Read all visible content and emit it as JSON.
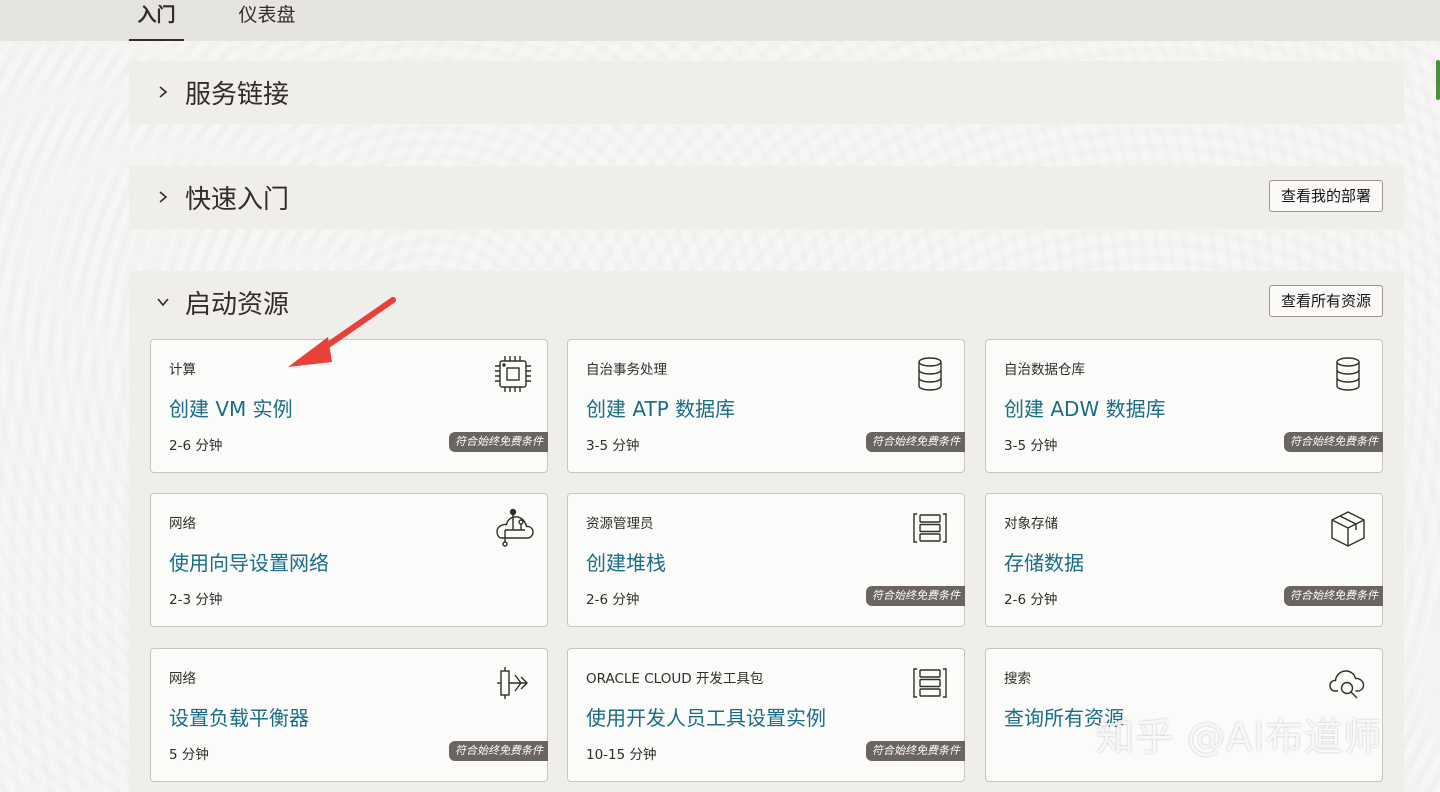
{
  "tabs": [
    {
      "label": "入门",
      "active": true
    },
    {
      "label": "仪表盘",
      "active": false
    }
  ],
  "panels": {
    "service_links": {
      "title": "服务链接"
    },
    "quick_start": {
      "title": "快速入门",
      "button": "查看我的部署"
    },
    "launch": {
      "title": "启动资源",
      "button": "查看所有资源"
    }
  },
  "cards": [
    {
      "category": "计算",
      "title": "创建 VM 实例",
      "time": "2-6 分钟",
      "badge": "符合始终免费条件",
      "icon": "chip-icon"
    },
    {
      "category": "自治事务处理",
      "title": "创建 ATP 数据库",
      "time": "3-5 分钟",
      "badge": "符合始终免费条件",
      "icon": "database-icon"
    },
    {
      "category": "自治数据仓库",
      "title": "创建 ADW 数据库",
      "time": "3-5 分钟",
      "badge": "符合始终免费条件",
      "icon": "database-icon"
    },
    {
      "category": "网络",
      "title": "使用向导设置网络",
      "time": "2-3 分钟",
      "badge": "",
      "icon": "cloud-network-icon"
    },
    {
      "category": "资源管理员",
      "title": "创建堆栈",
      "time": "2-6 分钟",
      "badge": "符合始终免费条件",
      "icon": "stack-icon"
    },
    {
      "category": "对象存储",
      "title": "存储数据",
      "time": "2-6 分钟",
      "badge": "符合始终免费条件",
      "icon": "box-icon"
    },
    {
      "category": "网络",
      "title": "设置负载平衡器",
      "time": "5 分钟",
      "badge": "符合始终免费条件",
      "icon": "load-balancer-icon"
    },
    {
      "category": "ORACLE CLOUD 开发工具包",
      "title": "使用开发人员工具设置实例",
      "time": "10-15 分钟",
      "badge": "符合始终免费条件",
      "icon": "stack-icon"
    },
    {
      "category": "搜索",
      "title": "查询所有资源",
      "time": "",
      "badge": "",
      "icon": "cloud-search-icon"
    }
  ],
  "watermark": "知乎 @AI布道师",
  "colors": {
    "link": "#1b6d85",
    "badge": "#6b6561",
    "arrow": "#e8413a"
  }
}
